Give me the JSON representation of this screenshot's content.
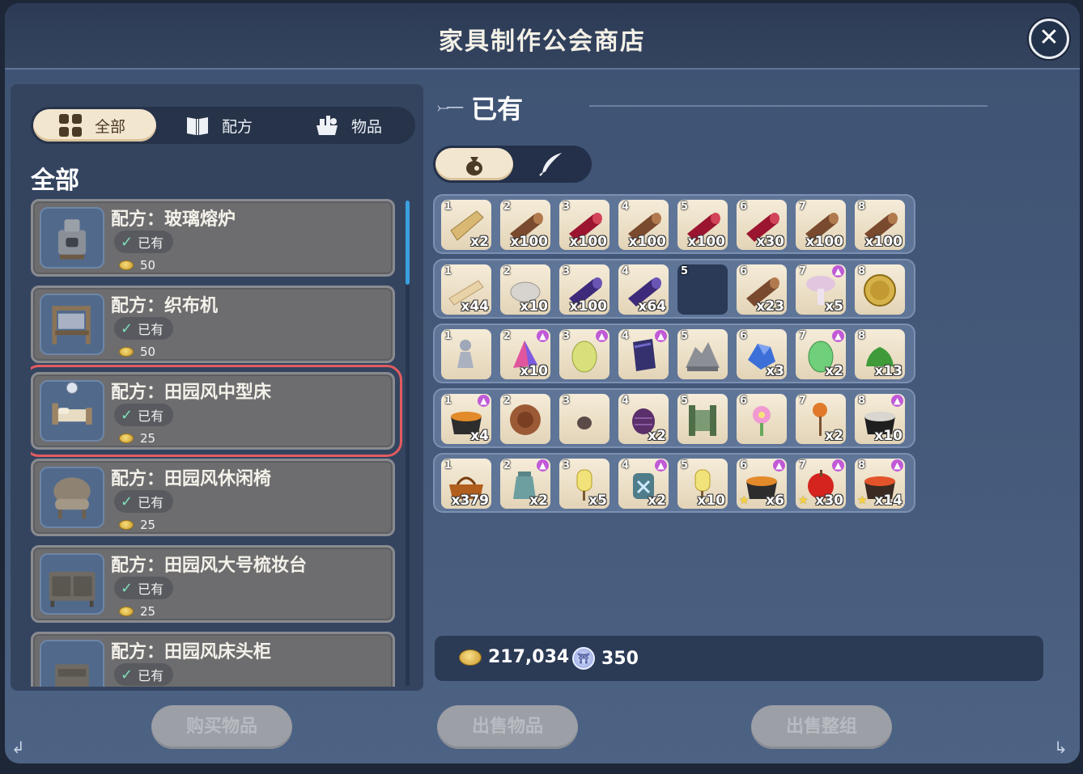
{
  "window": {
    "title": "家具制作公会商店",
    "close_label": "✕"
  },
  "category_tabs": [
    {
      "label": "全部",
      "icon": "grid-icon",
      "active": true
    },
    {
      "label": "配方",
      "icon": "book-icon",
      "active": false
    },
    {
      "label": "物品",
      "icon": "items-icon",
      "active": false
    }
  ],
  "section_title": "全部",
  "recipes": [
    {
      "name": "配方：玻璃熔炉",
      "status": "已有",
      "price": "50"
    },
    {
      "name": "配方：织布机",
      "status": "已有",
      "price": "50"
    },
    {
      "name": "配方：田园风中型床",
      "status": "已有",
      "price": "25",
      "selected": true
    },
    {
      "name": "配方：田园风休闲椅",
      "status": "已有",
      "price": "25"
    },
    {
      "name": "配方：田园风大号梳妆台",
      "status": "已有",
      "price": "25"
    },
    {
      "name": "配方：田园风床头柜",
      "status": "已有",
      "price": ""
    }
  ],
  "owned_header": "已有",
  "inventory_rows": [
    [
      {
        "n": "1",
        "q": "x2",
        "art": "plank-tag"
      },
      {
        "n": "2",
        "q": "x100",
        "art": "log-brown"
      },
      {
        "n": "3",
        "q": "x100",
        "art": "log-red"
      },
      {
        "n": "4",
        "q": "x100",
        "art": "log-brown"
      },
      {
        "n": "5",
        "q": "x100",
        "art": "log-red"
      },
      {
        "n": "6",
        "q": "x30",
        "art": "log-red"
      },
      {
        "n": "7",
        "q": "x100",
        "art": "log-brown"
      },
      {
        "n": "8",
        "q": "x100",
        "art": "log-brown"
      }
    ],
    [
      {
        "n": "1",
        "q": "x44",
        "art": "plank-light"
      },
      {
        "n": "2",
        "q": "x10",
        "art": "stone"
      },
      {
        "n": "3",
        "q": "x100",
        "art": "log-purple"
      },
      {
        "n": "4",
        "q": "x64",
        "art": "log-purple"
      },
      {
        "n": "5",
        "q": "",
        "art": "",
        "empty": true
      },
      {
        "n": "6",
        "q": "x23",
        "art": "log-brown"
      },
      {
        "n": "7",
        "q": "x5",
        "art": "mushroom",
        "up": true
      },
      {
        "n": "8",
        "q": "",
        "art": "coin-medal"
      }
    ],
    [
      {
        "n": "1",
        "q": "",
        "art": "figure"
      },
      {
        "n": "2",
        "q": "x10",
        "art": "crystal-pink",
        "up": true
      },
      {
        "n": "3",
        "q": "",
        "art": "egg-yellow",
        "up": true
      },
      {
        "n": "4",
        "q": "",
        "art": "cloth-dark",
        "up": true
      },
      {
        "n": "5",
        "q": "",
        "art": "rock-pile"
      },
      {
        "n": "6",
        "q": "x3",
        "art": "ore-blue"
      },
      {
        "n": "7",
        "q": "x2",
        "art": "egg-green",
        "up": true
      },
      {
        "n": "8",
        "q": "x13",
        "art": "slime-green"
      }
    ],
    [
      {
        "n": "1",
        "q": "x4",
        "art": "pot-stew",
        "up": true
      },
      {
        "n": "2",
        "q": "",
        "art": "wood-disc"
      },
      {
        "n": "3",
        "q": "",
        "art": "seed"
      },
      {
        "n": "4",
        "q": "x2",
        "art": "pinecone"
      },
      {
        "n": "5",
        "q": "",
        "art": "gate"
      },
      {
        "n": "6",
        "q": "",
        "art": "flower"
      },
      {
        "n": "7",
        "q": "x2",
        "art": "pumpkin-stick"
      },
      {
        "n": "8",
        "q": "x10",
        "art": "pot-soup",
        "up": true
      }
    ],
    [
      {
        "n": "1",
        "q": "x379",
        "art": "bag"
      },
      {
        "n": "2",
        "q": "x2",
        "art": "jug",
        "up": true
      },
      {
        "n": "3",
        "q": "x5",
        "art": "lantern"
      },
      {
        "n": "4",
        "q": "x2",
        "art": "jar",
        "up": true
      },
      {
        "n": "5",
        "q": "x10",
        "art": "lantern"
      },
      {
        "n": "6",
        "q": "x6",
        "art": "pot-stew",
        "up": true,
        "star": true
      },
      {
        "n": "7",
        "q": "x30",
        "art": "apple",
        "up": true,
        "star": true
      },
      {
        "n": "8",
        "q": "x14",
        "art": "stew-red",
        "up": true,
        "star": true
      }
    ]
  ],
  "currency": {
    "gold": "217,034",
    "token": "350"
  },
  "buttons": {
    "buy": "购买物品",
    "sell": "出售物品",
    "sell_group": "出售整组"
  }
}
